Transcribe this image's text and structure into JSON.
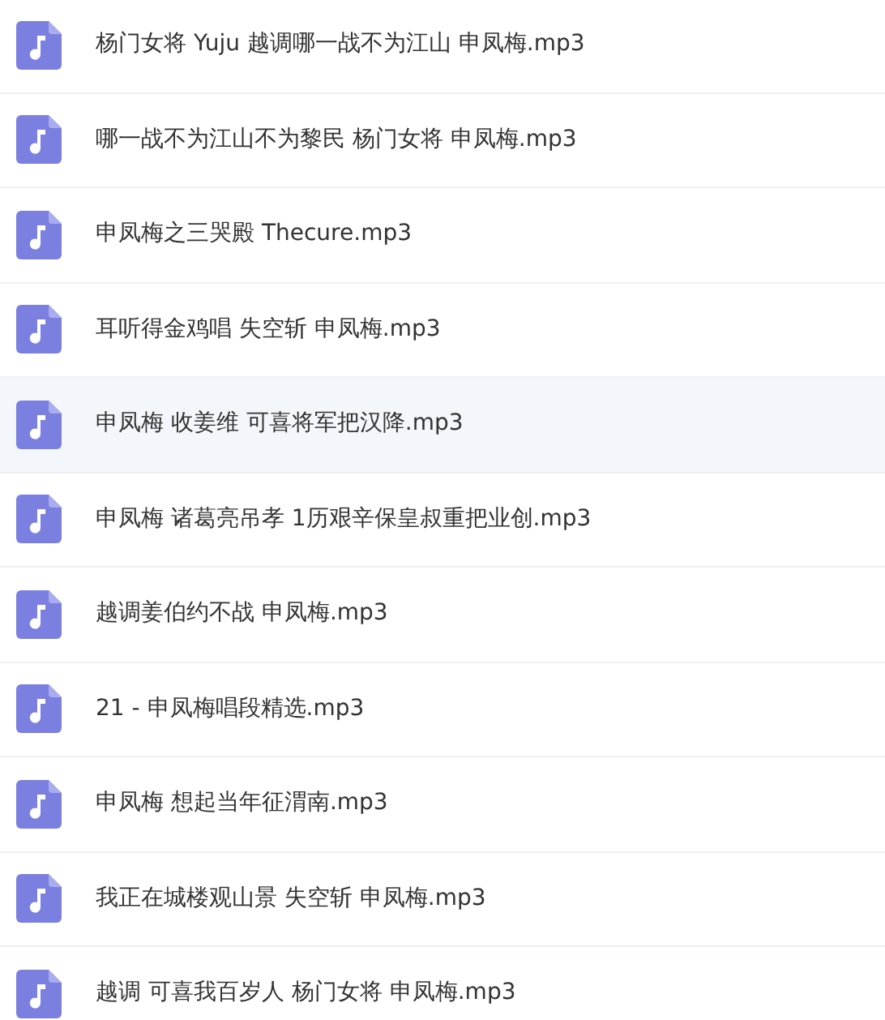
{
  "files": [
    {
      "name": "杨门女将 Yuju 越调哪一战不为江山 申凤梅.mp3",
      "selected": false
    },
    {
      "name": "哪一战不为江山不为黎民 杨门女将 申凤梅.mp3",
      "selected": false
    },
    {
      "name": "申凤梅之三哭殿 Thecure.mp3",
      "selected": false
    },
    {
      "name": "耳听得金鸡唱 失空斩 申凤梅.mp3",
      "selected": false
    },
    {
      "name": "申凤梅 收姜维 可喜将军把汉降.mp3",
      "selected": true
    },
    {
      "name": "申凤梅 诸葛亮吊孝 1历艰辛保皇叔重把业创.mp3",
      "selected": false
    },
    {
      "name": "越调姜伯约不战 申凤梅.mp3",
      "selected": false
    },
    {
      "name": "21 - 申凤梅唱段精选.mp3",
      "selected": false
    },
    {
      "name": "申凤梅 想起当年征渭南.mp3",
      "selected": false
    },
    {
      "name": "我正在城楼观山景 失空斩 申凤梅.mp3",
      "selected": false
    },
    {
      "name": "越调 可喜我百岁人 杨门女将 申凤梅.mp3",
      "selected": false
    }
  ]
}
